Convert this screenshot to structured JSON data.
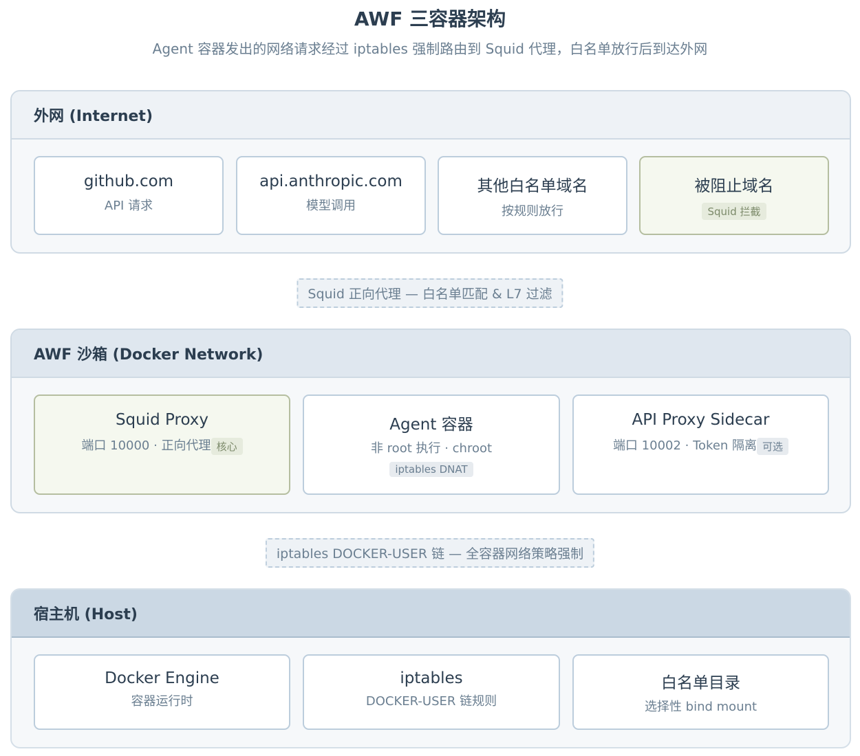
{
  "header": {
    "title": "AWF 三容器架构",
    "subtitle": "Agent 容器发出的网络请求经过 iptables 强制路由到 Squid 代理，白名单放行后到达外网"
  },
  "layers": {
    "internet": {
      "title": "外网 (Internet)",
      "boxes": [
        {
          "title": "github.com",
          "sub": "API 请求"
        },
        {
          "title": "api.anthropic.com",
          "sub": "模型调用"
        },
        {
          "title": "其他白名单域名",
          "sub": "按规则放行"
        },
        {
          "title": "被阻止域名",
          "tag": "Squid 拦截"
        }
      ]
    },
    "sandbox": {
      "title": "AWF 沙箱 (Docker Network)",
      "boxes": [
        {
          "title": "Squid Proxy",
          "sub": "端口 10000 · 正向代理",
          "tag": "核心"
        },
        {
          "title": "Agent 容器",
          "sub": "非 root 执行 · chroot",
          "tag": "iptables DNAT"
        },
        {
          "title": "API Proxy Sidecar",
          "sub": "端口 10002 · Token 隔离",
          "tag": "可选"
        }
      ]
    },
    "host": {
      "title": "宿主机 (Host)",
      "boxes": [
        {
          "title": "Docker Engine",
          "sub": "容器运行时"
        },
        {
          "title": "iptables",
          "sub": "DOCKER-USER 链规则"
        },
        {
          "title": "白名单目录",
          "sub": "选择性 bind mount"
        }
      ]
    }
  },
  "connectors": {
    "squid": "Squid 正向代理 — 白名单匹配 & L7 过滤",
    "iptables": "iptables DOCKER-USER 链 — 全容器网络策略强制"
  },
  "colors": {
    "allowed_border": "#bccddc",
    "blocked_border": "#b5bea0",
    "blocked_fill": "#f5f8ef"
  }
}
